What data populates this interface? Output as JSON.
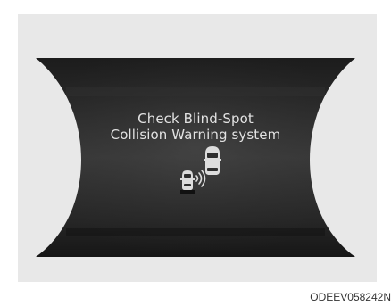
{
  "display": {
    "message_line1": "Check Blind-Spot",
    "message_line2": "Collision Warning system",
    "icon": "blind-spot-collision-warning-icon",
    "text_color": "#e2e2e2",
    "panel_color": "#1e1e1e"
  },
  "caption": {
    "code": "ODEEV058242N"
  }
}
